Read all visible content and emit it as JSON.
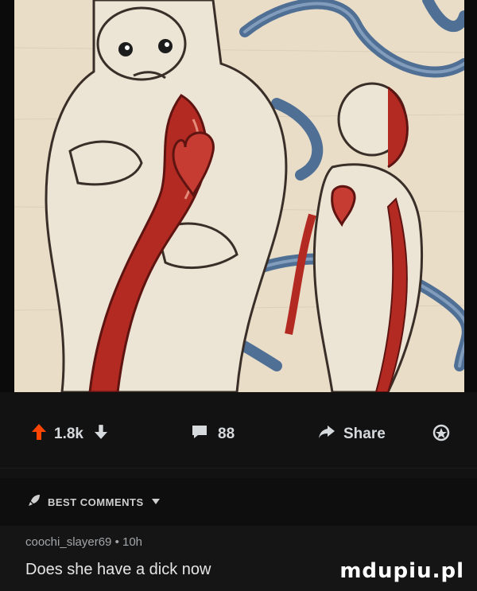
{
  "post": {
    "image_alt": "illustration of two figures with a shared vein-like ribbon and heart",
    "upvotes": "1.8k",
    "comments_count": "88",
    "share_label": "Share"
  },
  "comments_section": {
    "sort_label": "BEST COMMENTS"
  },
  "comment": {
    "author": "coochi_slayer69",
    "age": "10h",
    "text": "Does she have a dick now"
  },
  "watermark": "mdupiu.pl",
  "colors": {
    "upvote_accent": "#ff4500",
    "art_background": "#e9ddc8",
    "ribbon_blue": "#5f7fa3",
    "vein_red": "#b32a23"
  }
}
